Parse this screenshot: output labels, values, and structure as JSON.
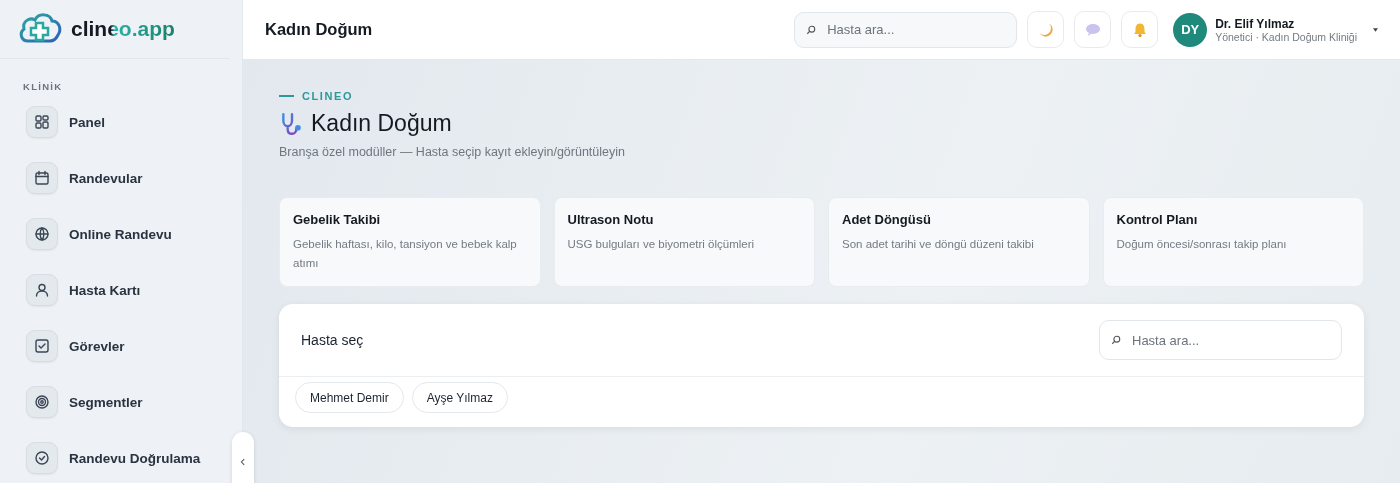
{
  "brand": {
    "logo": "clineo.app"
  },
  "sidebar": {
    "section": "KLİNİK",
    "items": [
      {
        "label": "Panel"
      },
      {
        "label": "Randevular"
      },
      {
        "label": "Online Randevu"
      },
      {
        "label": "Hasta Kartı"
      },
      {
        "label": "Görevler"
      },
      {
        "label": "Segmentler"
      },
      {
        "label": "Randevu Doğrulama"
      }
    ]
  },
  "header": {
    "title": "Kadın Doğum",
    "search": {
      "placeholder": "Hasta ara..."
    },
    "user": {
      "initials": "DY",
      "name": "Dr. Elif Yılmaz",
      "role": "Yönetici · Kadın Doğum Kliniği"
    }
  },
  "page": {
    "eyebrow": "CLINEO",
    "title": "Kadın Doğum",
    "subtitle": "Branşa özel modüller — Hasta seçip kayıt ekleyin/görüntüleyin",
    "modules": [
      {
        "title": "Gebelik Takibi",
        "description": "Gebelik haftası, kilo, tansiyon ve bebek kalp atımı"
      },
      {
        "title": "Ultrason Notu",
        "description": "USG bulguları ve biyometri ölçümleri"
      },
      {
        "title": "Adet Döngüsü",
        "description": "Son adet tarihi ve döngü düzeni takibi"
      },
      {
        "title": "Kontrol Planı",
        "description": "Doğum öncesi/sonrası takip planı"
      }
    ],
    "patient_picker": {
      "title": "Hasta seç",
      "search": {
        "placeholder": "Hasta ara..."
      },
      "patients": [
        "Mehmet Demir",
        "Ayşe Yılmaz"
      ]
    }
  }
}
